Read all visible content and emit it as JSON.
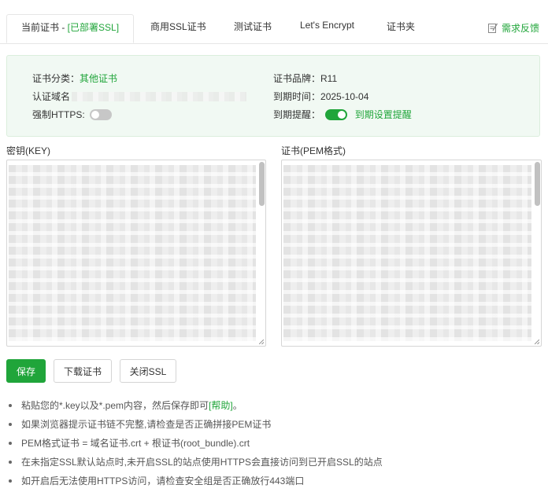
{
  "tabs": [
    {
      "label_prefix": "当前证书 - ",
      "label_suffix": "[已部署SSL]"
    },
    {
      "label": "商用SSL证书"
    },
    {
      "label": "测试证书"
    },
    {
      "label": "Let's Encrypt"
    },
    {
      "label": "证书夹"
    }
  ],
  "feedback": {
    "label": "需求反馈",
    "icon": "edit-icon"
  },
  "info": {
    "category_label": "证书分类：",
    "category_value": "其他证书",
    "brand_label": "证书品牌：",
    "brand_value": "R11",
    "domain_label": "认证域名",
    "expire_label": "到期时间：",
    "expire_value": "2025-10-04",
    "force_https_label": "强制HTTPS:",
    "force_https_on": false,
    "expire_remind_label": "到期提醒：",
    "expire_remind_on": true,
    "expire_remind_link": "到期设置提醒"
  },
  "key_area": {
    "label": "密钥(KEY)"
  },
  "cert_area": {
    "label": "证书(PEM格式)"
  },
  "buttons": {
    "save": "保存",
    "download": "下载证书",
    "close_ssl": "关闭SSL"
  },
  "tips": [
    {
      "text": "粘贴您的*.key以及*.pem内容，然后保存即可",
      "link": "[帮助]",
      "tail": "。"
    },
    {
      "text": "如果浏览器提示证书链不完整,请检查是否正确拼接PEM证书"
    },
    {
      "text": "PEM格式证书 = 域名证书.crt + 根证书(root_bundle).crt"
    },
    {
      "text": "在未指定SSL默认站点时,未开启SSL的站点使用HTTPS会直接访问到已开启SSL的站点"
    },
    {
      "text": "如开启后无法使用HTTPS访问，请检查安全组是否正确放行443端口"
    }
  ],
  "colors": {
    "accent": "#20a53a",
    "info_bg": "#f1f9f3",
    "border": "#d5d5d5"
  }
}
